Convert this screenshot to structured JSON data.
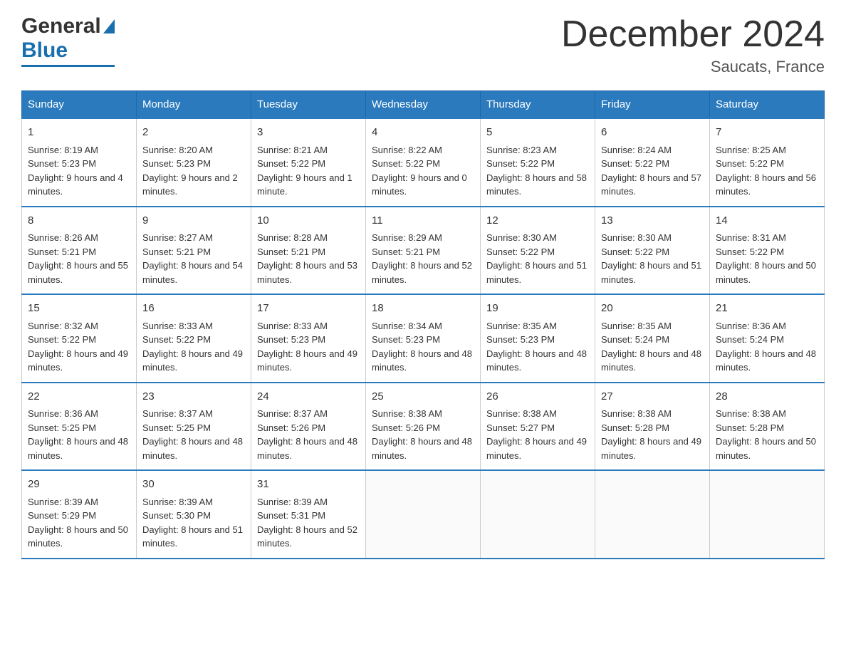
{
  "header": {
    "month_title": "December 2024",
    "location": "Saucats, France"
  },
  "days_of_week": [
    "Sunday",
    "Monday",
    "Tuesday",
    "Wednesday",
    "Thursday",
    "Friday",
    "Saturday"
  ],
  "weeks": [
    [
      {
        "day": "1",
        "sunrise": "Sunrise: 8:19 AM",
        "sunset": "Sunset: 5:23 PM",
        "daylight": "Daylight: 9 hours and 4 minutes."
      },
      {
        "day": "2",
        "sunrise": "Sunrise: 8:20 AM",
        "sunset": "Sunset: 5:23 PM",
        "daylight": "Daylight: 9 hours and 2 minutes."
      },
      {
        "day": "3",
        "sunrise": "Sunrise: 8:21 AM",
        "sunset": "Sunset: 5:22 PM",
        "daylight": "Daylight: 9 hours and 1 minute."
      },
      {
        "day": "4",
        "sunrise": "Sunrise: 8:22 AM",
        "sunset": "Sunset: 5:22 PM",
        "daylight": "Daylight: 9 hours and 0 minutes."
      },
      {
        "day": "5",
        "sunrise": "Sunrise: 8:23 AM",
        "sunset": "Sunset: 5:22 PM",
        "daylight": "Daylight: 8 hours and 58 minutes."
      },
      {
        "day": "6",
        "sunrise": "Sunrise: 8:24 AM",
        "sunset": "Sunset: 5:22 PM",
        "daylight": "Daylight: 8 hours and 57 minutes."
      },
      {
        "day": "7",
        "sunrise": "Sunrise: 8:25 AM",
        "sunset": "Sunset: 5:22 PM",
        "daylight": "Daylight: 8 hours and 56 minutes."
      }
    ],
    [
      {
        "day": "8",
        "sunrise": "Sunrise: 8:26 AM",
        "sunset": "Sunset: 5:21 PM",
        "daylight": "Daylight: 8 hours and 55 minutes."
      },
      {
        "day": "9",
        "sunrise": "Sunrise: 8:27 AM",
        "sunset": "Sunset: 5:21 PM",
        "daylight": "Daylight: 8 hours and 54 minutes."
      },
      {
        "day": "10",
        "sunrise": "Sunrise: 8:28 AM",
        "sunset": "Sunset: 5:21 PM",
        "daylight": "Daylight: 8 hours and 53 minutes."
      },
      {
        "day": "11",
        "sunrise": "Sunrise: 8:29 AM",
        "sunset": "Sunset: 5:21 PM",
        "daylight": "Daylight: 8 hours and 52 minutes."
      },
      {
        "day": "12",
        "sunrise": "Sunrise: 8:30 AM",
        "sunset": "Sunset: 5:22 PM",
        "daylight": "Daylight: 8 hours and 51 minutes."
      },
      {
        "day": "13",
        "sunrise": "Sunrise: 8:30 AM",
        "sunset": "Sunset: 5:22 PM",
        "daylight": "Daylight: 8 hours and 51 minutes."
      },
      {
        "day": "14",
        "sunrise": "Sunrise: 8:31 AM",
        "sunset": "Sunset: 5:22 PM",
        "daylight": "Daylight: 8 hours and 50 minutes."
      }
    ],
    [
      {
        "day": "15",
        "sunrise": "Sunrise: 8:32 AM",
        "sunset": "Sunset: 5:22 PM",
        "daylight": "Daylight: 8 hours and 49 minutes."
      },
      {
        "day": "16",
        "sunrise": "Sunrise: 8:33 AM",
        "sunset": "Sunset: 5:22 PM",
        "daylight": "Daylight: 8 hours and 49 minutes."
      },
      {
        "day": "17",
        "sunrise": "Sunrise: 8:33 AM",
        "sunset": "Sunset: 5:23 PM",
        "daylight": "Daylight: 8 hours and 49 minutes."
      },
      {
        "day": "18",
        "sunrise": "Sunrise: 8:34 AM",
        "sunset": "Sunset: 5:23 PM",
        "daylight": "Daylight: 8 hours and 48 minutes."
      },
      {
        "day": "19",
        "sunrise": "Sunrise: 8:35 AM",
        "sunset": "Sunset: 5:23 PM",
        "daylight": "Daylight: 8 hours and 48 minutes."
      },
      {
        "day": "20",
        "sunrise": "Sunrise: 8:35 AM",
        "sunset": "Sunset: 5:24 PM",
        "daylight": "Daylight: 8 hours and 48 minutes."
      },
      {
        "day": "21",
        "sunrise": "Sunrise: 8:36 AM",
        "sunset": "Sunset: 5:24 PM",
        "daylight": "Daylight: 8 hours and 48 minutes."
      }
    ],
    [
      {
        "day": "22",
        "sunrise": "Sunrise: 8:36 AM",
        "sunset": "Sunset: 5:25 PM",
        "daylight": "Daylight: 8 hours and 48 minutes."
      },
      {
        "day": "23",
        "sunrise": "Sunrise: 8:37 AM",
        "sunset": "Sunset: 5:25 PM",
        "daylight": "Daylight: 8 hours and 48 minutes."
      },
      {
        "day": "24",
        "sunrise": "Sunrise: 8:37 AM",
        "sunset": "Sunset: 5:26 PM",
        "daylight": "Daylight: 8 hours and 48 minutes."
      },
      {
        "day": "25",
        "sunrise": "Sunrise: 8:38 AM",
        "sunset": "Sunset: 5:26 PM",
        "daylight": "Daylight: 8 hours and 48 minutes."
      },
      {
        "day": "26",
        "sunrise": "Sunrise: 8:38 AM",
        "sunset": "Sunset: 5:27 PM",
        "daylight": "Daylight: 8 hours and 49 minutes."
      },
      {
        "day": "27",
        "sunrise": "Sunrise: 8:38 AM",
        "sunset": "Sunset: 5:28 PM",
        "daylight": "Daylight: 8 hours and 49 minutes."
      },
      {
        "day": "28",
        "sunrise": "Sunrise: 8:38 AM",
        "sunset": "Sunset: 5:28 PM",
        "daylight": "Daylight: 8 hours and 50 minutes."
      }
    ],
    [
      {
        "day": "29",
        "sunrise": "Sunrise: 8:39 AM",
        "sunset": "Sunset: 5:29 PM",
        "daylight": "Daylight: 8 hours and 50 minutes."
      },
      {
        "day": "30",
        "sunrise": "Sunrise: 8:39 AM",
        "sunset": "Sunset: 5:30 PM",
        "daylight": "Daylight: 8 hours and 51 minutes."
      },
      {
        "day": "31",
        "sunrise": "Sunrise: 8:39 AM",
        "sunset": "Sunset: 5:31 PM",
        "daylight": "Daylight: 8 hours and 52 minutes."
      },
      null,
      null,
      null,
      null
    ]
  ]
}
